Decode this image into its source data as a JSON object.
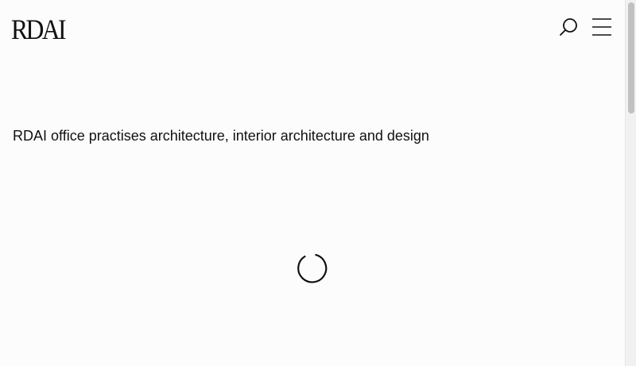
{
  "header": {
    "logo_text": "RDAI",
    "search_icon": "search-icon",
    "menu_icon": "hamburger-menu-icon"
  },
  "main": {
    "tagline": "RDAI office practises architecture, interior architecture and design",
    "loading_icon": "loading-spinner-icon"
  },
  "colors": {
    "background": "#fcfcfc",
    "text": "#111111",
    "scrollbar_track": "#f1f1f1",
    "scrollbar_thumb": "#c1c1c1"
  }
}
